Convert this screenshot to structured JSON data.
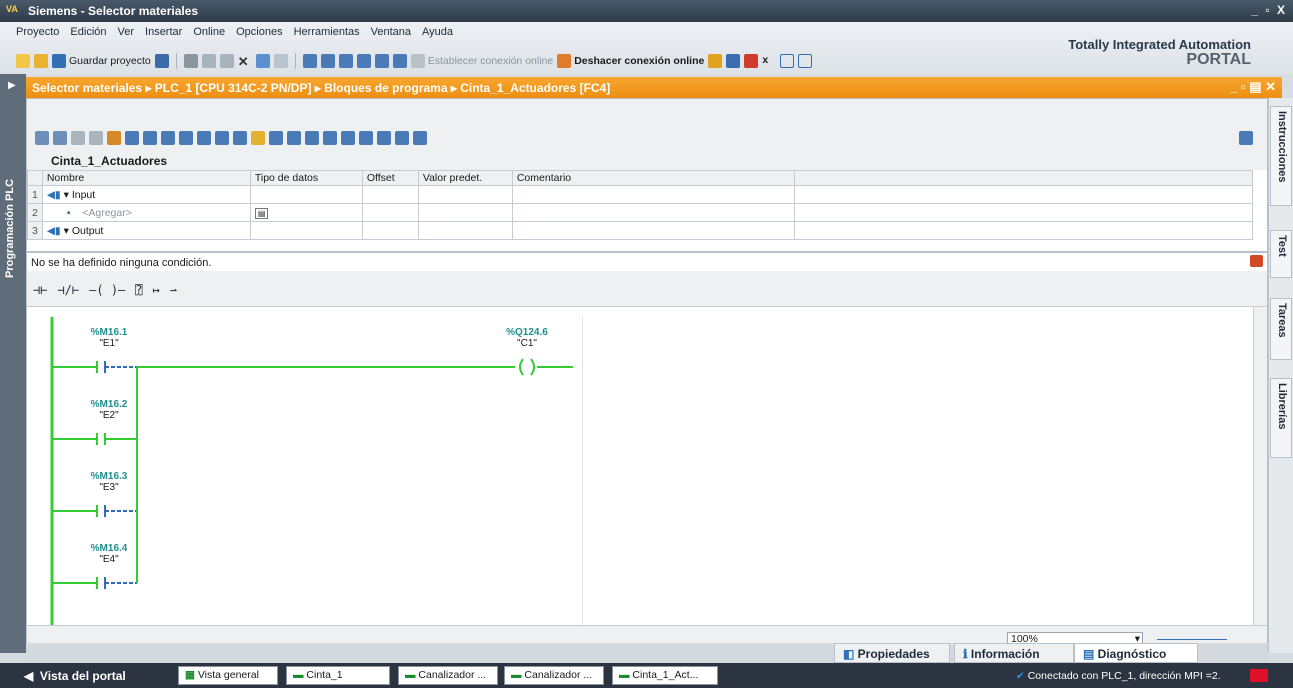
{
  "window": {
    "title": "Siemens  -  Selector materiales",
    "controls": "_ ▫ X"
  },
  "menu": [
    "Proyecto",
    "Edición",
    "Ver",
    "Insertar",
    "Online",
    "Opciones",
    "Herramientas",
    "Ventana",
    "Ayuda"
  ],
  "toolbar": {
    "save_label": "Guardar proyecto",
    "connect_online": "Establecer conexión online",
    "disconnect_online": "Deshacer conexión online"
  },
  "brand": {
    "line1": "Totally Integrated Automation",
    "line2": "PORTAL"
  },
  "breadcrumb": {
    "text": "Selector materiales  ▸  PLC_1 [CPU 314C-2 PN/DP]  ▸  Bloques de programa  ▸  Cinta_1_Actuadores [FC4]"
  },
  "left_panel": {
    "label": "Programación PLC"
  },
  "right_tabs": {
    "instrucciones": "Instrucciones",
    "test": "Test",
    "tareas": "Tareas",
    "librerias": "Librerías"
  },
  "interface": {
    "block_name": "Cinta_1_Actuadores",
    "columns": [
      "Nombre",
      "Tipo de datos",
      "Offset",
      "Valor predet.",
      "Comentario"
    ],
    "rows": [
      {
        "num": "1",
        "name": "▾  Input"
      },
      {
        "num": "2",
        "name": "<Agregar>"
      },
      {
        "num": "3",
        "name": "▾  Output"
      }
    ]
  },
  "condition": {
    "text": "No se ha definido ninguna condición."
  },
  "ladder": {
    "contacts": [
      {
        "addr": "%M16.1",
        "sym": "\"E1\""
      },
      {
        "addr": "%M16.2",
        "sym": "\"E2\""
      },
      {
        "addr": "%M16.3",
        "sym": "\"E3\""
      },
      {
        "addr": "%M16.4",
        "sym": "\"E4\""
      }
    ],
    "coil": {
      "addr": "%Q124.6",
      "sym": "\"C1\""
    }
  },
  "zoom": {
    "value": "100%"
  },
  "bottom_tabs": {
    "propiedades": "Propiedades",
    "informacion": "Información",
    "diagnostico": "Diagnóstico"
  },
  "statusbar": {
    "portal_view": "Vista del portal",
    "tasks": [
      "Vista general",
      "Cinta_1",
      "Canalizador ...",
      "Canalizador ...",
      "Cinta_1_Act..."
    ],
    "connection": "Conectado con PLC_1, dirección MPI =2."
  },
  "colors": {
    "orange": "#f29a1f",
    "ladder_green": "#33cc33",
    "address_teal": "#1f8f8f"
  }
}
